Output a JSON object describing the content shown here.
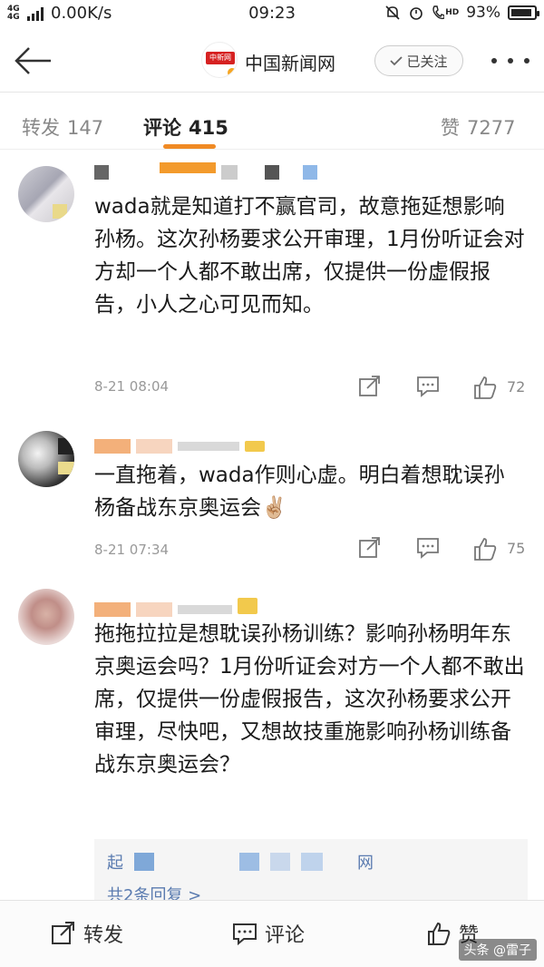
{
  "status_bar": {
    "network": "4G 4G",
    "speed": "0.00K/s",
    "time": "09:23",
    "battery": "93%",
    "battery_level": 0.93,
    "hd_label": "HD"
  },
  "header": {
    "title": "中国新闻网",
    "follow_label": "已关注",
    "logo_text": "中新网"
  },
  "tabs": [
    {
      "label": "转发",
      "count": "147"
    },
    {
      "label": "评论",
      "count": "415"
    },
    {
      "label": "赞",
      "count": "7277"
    }
  ],
  "comments": [
    {
      "text": "wada就是知道打不赢官司，故意拖延想影响孙杨。这次孙杨要求公开审理，1月份听证会对方却一个人都不敢出席，仅提供一份虚假报告，小人之心可见而知。",
      "time": "8-21 08:04",
      "likes": "72"
    },
    {
      "text": "一直拖着，wada作则心虚。明白着想耽误孙杨备战东京奥运会✌🏼",
      "time": "8-21 07:34",
      "likes": "75"
    },
    {
      "text": "拖拖拉拉是想耽误孙杨训练？影响孙杨明年东京奥运会吗？1月份听证会对方一个人都不敢出席，仅提供一份虚假报告，这次孙杨要求公开审理，尽快吧，又想故技重施影响孙杨训练备战东京奥运会？"
    }
  ],
  "reply": {
    "prefix": "起",
    "suffix": "网",
    "more": "共2条回复 >"
  },
  "bottom_bar": {
    "repost": "转发",
    "comment": "评论",
    "like": "赞"
  },
  "watermark": "头条 @雷子",
  "colors": {
    "accent": "#f08a24",
    "link": "#5a7bb0"
  }
}
